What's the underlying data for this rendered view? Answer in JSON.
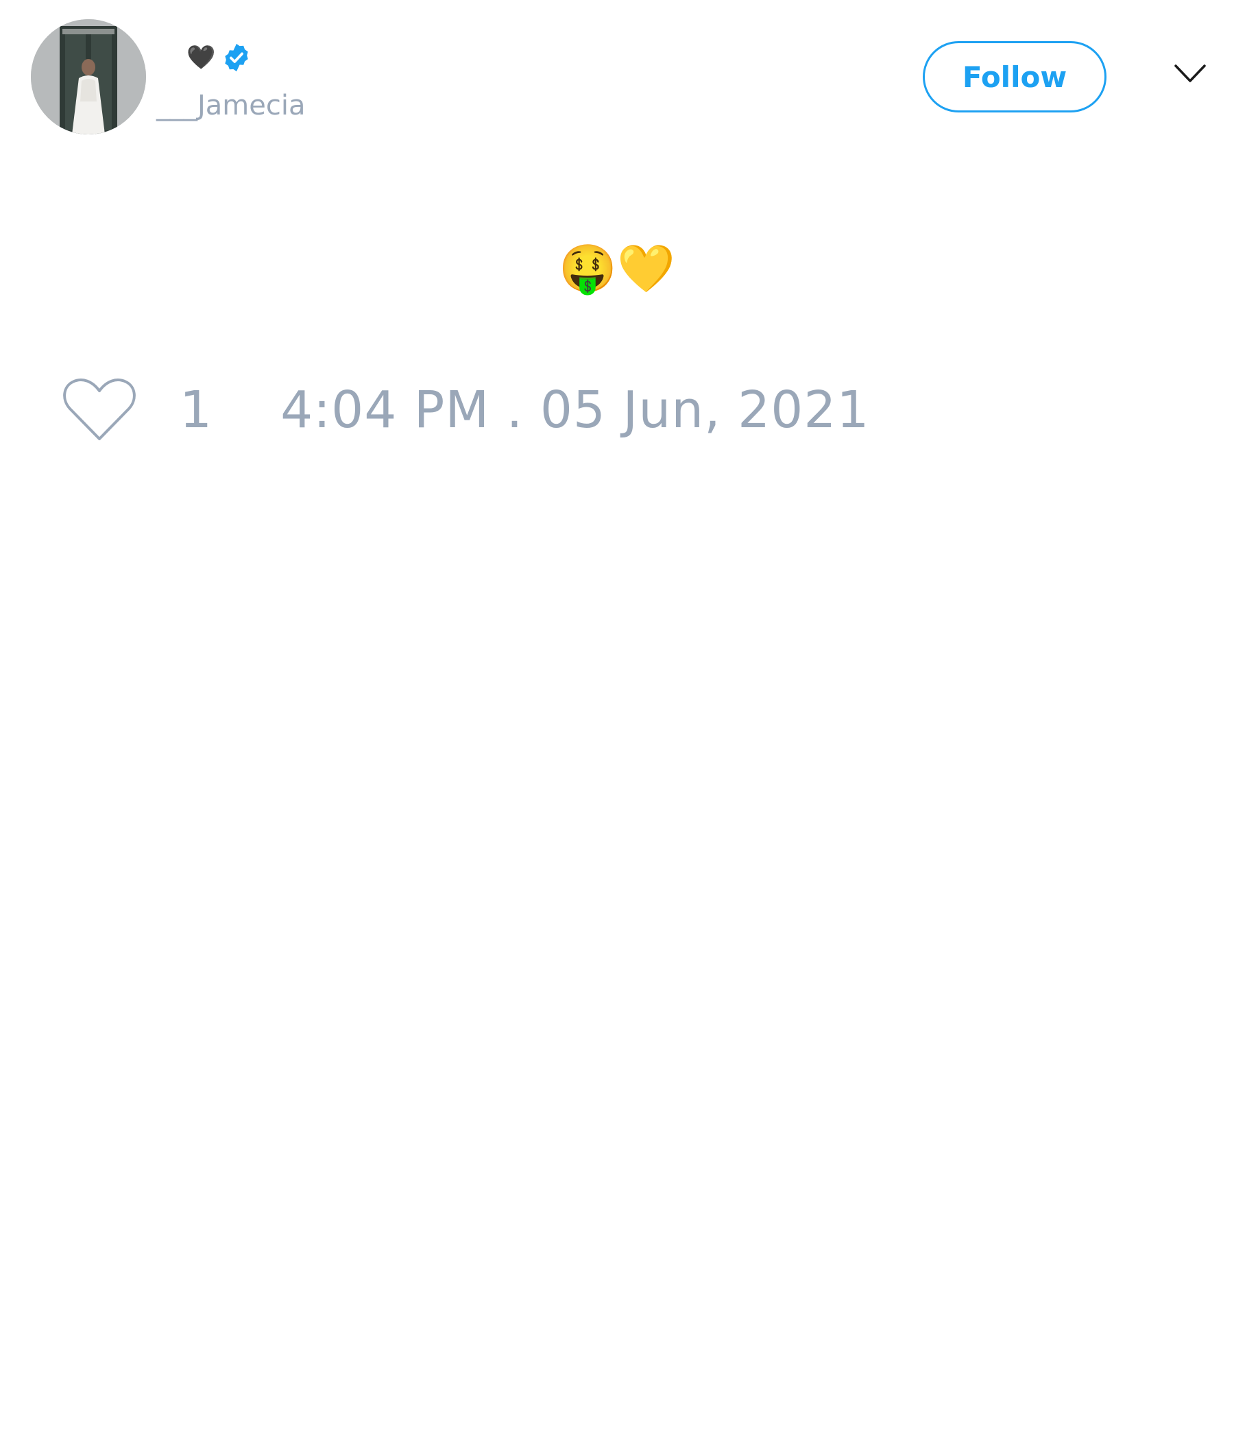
{
  "author": {
    "display_name_glyph": "🖤",
    "handle": "___Jamecia"
  },
  "header": {
    "follow_label": "Follow"
  },
  "tweet": {
    "text": "🤑💛",
    "like_count": "1",
    "timestamp": "4:04 PM . 05 Jun, 2021"
  },
  "colors": {
    "accent": "#1da1f2",
    "muted_text": "#9aa7b8",
    "background": "#ffffff"
  },
  "icons": {
    "avatar": "avatar-photo",
    "verified": "verified-badge-icon",
    "menu": "chevron-down-icon",
    "like": "heart-outline-icon"
  }
}
